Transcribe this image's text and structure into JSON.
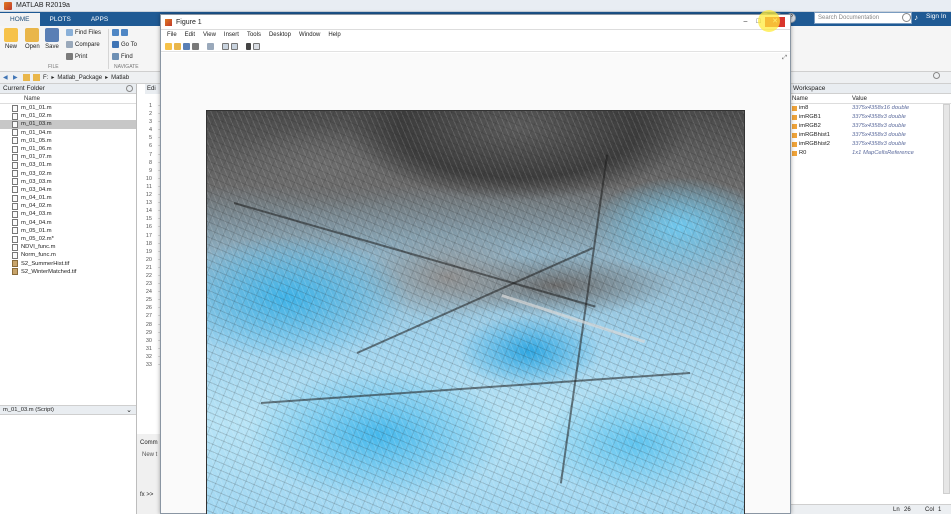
{
  "app": {
    "title": "MATLAB R2019a"
  },
  "ribbon_tabs": [
    "HOME",
    "PLOTS",
    "APPS"
  ],
  "search": {
    "placeholder": "Search Documentation"
  },
  "signin": "Sign In",
  "toolstrip": {
    "new": "New",
    "open": "Open",
    "save": "Save",
    "find_files": "Find Files",
    "compare": "Compare",
    "print": "Print",
    "go_to": "Go To",
    "find": "Find",
    "group_file": "FILE",
    "group_navigate": "NAVIGATE"
  },
  "address": {
    "path": [
      "F:",
      "Matlab_Package",
      "Matlab"
    ]
  },
  "current_folder": {
    "title": "Current Folder",
    "column_name": "Name",
    "files": [
      {
        "name": "m_01_01.m",
        "type": "m"
      },
      {
        "name": "m_01_02.m",
        "type": "m"
      },
      {
        "name": "m_01_03.m",
        "type": "m",
        "selected": true
      },
      {
        "name": "m_01_04.m",
        "type": "m"
      },
      {
        "name": "m_01_05.m",
        "type": "m"
      },
      {
        "name": "m_01_06.m",
        "type": "m"
      },
      {
        "name": "m_01_07.m",
        "type": "m"
      },
      {
        "name": "m_03_01.m",
        "type": "m"
      },
      {
        "name": "m_03_02.m",
        "type": "m"
      },
      {
        "name": "m_03_03.m",
        "type": "m"
      },
      {
        "name": "m_03_04.m",
        "type": "m"
      },
      {
        "name": "m_04_01.m",
        "type": "m"
      },
      {
        "name": "m_04_02.m",
        "type": "m"
      },
      {
        "name": "m_04_03.m",
        "type": "m"
      },
      {
        "name": "m_04_04.m",
        "type": "m"
      },
      {
        "name": "m_05_01.m",
        "type": "m"
      },
      {
        "name": "m_05_02.m*",
        "type": "m"
      },
      {
        "name": "NDVI_func.m",
        "type": "m"
      },
      {
        "name": "Norm_func.m",
        "type": "m"
      },
      {
        "name": "S2_SummerHist.tif",
        "type": "tif"
      },
      {
        "name": "S2_WinterMatched.tif",
        "type": "tif"
      }
    ],
    "details": "m_01_03.m  (Script)"
  },
  "editor": {
    "tab": "Edi",
    "lines": [
      "1",
      "2",
      "3",
      "4",
      "5",
      "6",
      "7",
      "8",
      "9",
      "10",
      "11",
      "12",
      "13",
      "14",
      "15",
      "16",
      "17",
      "18",
      "19",
      "20",
      "21",
      "22",
      "23",
      "24",
      "25",
      "26",
      "27",
      "28",
      "29",
      "30",
      "31",
      "32",
      "33"
    ]
  },
  "command_window": {
    "label": "Comm",
    "new_text": "New t",
    "prompt": "fx >>"
  },
  "workspace": {
    "title": "Workspace",
    "col_name": "Name",
    "col_value": "Value",
    "vars": [
      {
        "name": "im8",
        "value": "3375x4358x16 double"
      },
      {
        "name": "imRGB1",
        "value": "3375x4358x3 double"
      },
      {
        "name": "imRGB2",
        "value": "3375x4358x3 double"
      },
      {
        "name": "imRGBhist1",
        "value": "3375x4358x3 double"
      },
      {
        "name": "imRGBhist2",
        "value": "3375x4358x3 double"
      },
      {
        "name": "R0",
        "value": "1x1 MapCellsReference"
      }
    ]
  },
  "statusbar": {
    "ln_label": "Ln",
    "ln": "26",
    "col_label": "Col",
    "col": "1"
  },
  "figure": {
    "title": "Figure 1",
    "menu": [
      "File",
      "Edit",
      "View",
      "Insert",
      "Tools",
      "Desktop",
      "Window",
      "Help"
    ]
  }
}
